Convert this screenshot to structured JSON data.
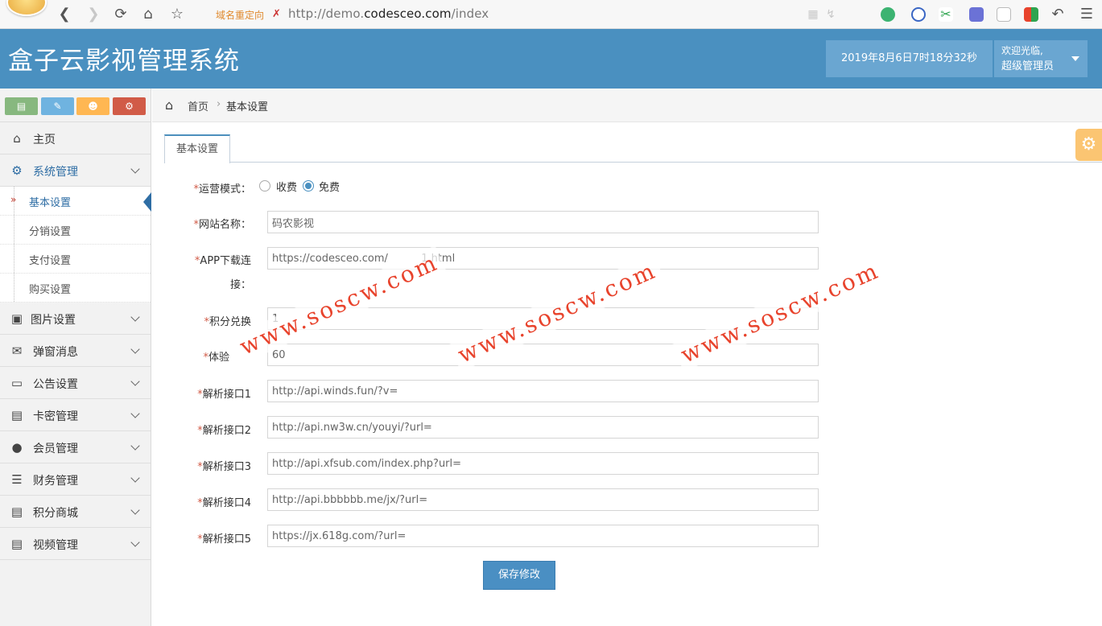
{
  "browser": {
    "redirect_label": "域名重定向",
    "url_prefix": "http://demo.",
    "url_domain": "codesceo.com",
    "url_path": "/index"
  },
  "header": {
    "title": "盒子云影视管理系统",
    "datetime": "2019年8月6日7时18分32秒",
    "welcome": "欢迎光临,",
    "user_role": "超级管理员"
  },
  "sidebar": {
    "shortcut_colors": [
      "#87b87f",
      "#6fb3e0",
      "#ffb752",
      "#d15b47"
    ],
    "items": [
      {
        "label": "主页",
        "icon": "home-icon"
      },
      {
        "label": "系统管理",
        "icon": "cogs-icon",
        "expanded": true,
        "children": [
          {
            "label": "基本设置",
            "active": true
          },
          {
            "label": "分销设置"
          },
          {
            "label": "支付设置"
          },
          {
            "label": "购买设置"
          }
        ]
      },
      {
        "label": "图片设置",
        "icon": "picture-icon"
      },
      {
        "label": "弹窗消息",
        "icon": "comments-icon"
      },
      {
        "label": "公告设置",
        "icon": "laptop-icon"
      },
      {
        "label": "卡密管理",
        "icon": "desktop-icon"
      },
      {
        "label": "会员管理",
        "icon": "user-icon"
      },
      {
        "label": "财务管理",
        "icon": "list-icon"
      },
      {
        "label": "积分商城",
        "icon": "desktop-icon"
      },
      {
        "label": "视频管理",
        "icon": "desktop-icon"
      }
    ]
  },
  "breadcrumb": {
    "home": "首页",
    "current": "基本设置"
  },
  "tabs": [
    {
      "label": "基本设置"
    }
  ],
  "form": {
    "mode_label": "运营模式：",
    "mode_options": [
      "收费",
      "免费"
    ],
    "mode_selected": "免费",
    "site_name_label": "网站名称：",
    "site_name_value": "码农影视",
    "app_link_label_1": "APP下载连",
    "app_link_label_2": "接：",
    "app_link_value": "https://codesceo.com/          1.html",
    "points_label": "积分兑换",
    "points_value": "1",
    "trial_label": "体验",
    "trial_value": "60",
    "api1_label": "解析接口1",
    "api1_value": "http://api.winds.fun/?v=",
    "api2_label": "解析接口2",
    "api2_value": "http://api.nw3w.cn/youyi/?url=",
    "api3_label": "解析接口3",
    "api3_value": "http://api.xfsub.com/index.php?url=",
    "api4_label": "解析接口4",
    "api4_value": "http://api.bbbbbb.me/jx/?url=",
    "api5_label": "解析接口5",
    "api5_value": "https://jx.618g.com/?url=",
    "save_label": "保存修改",
    "required_mark": "*"
  },
  "watermark": "www.soscw.com"
}
